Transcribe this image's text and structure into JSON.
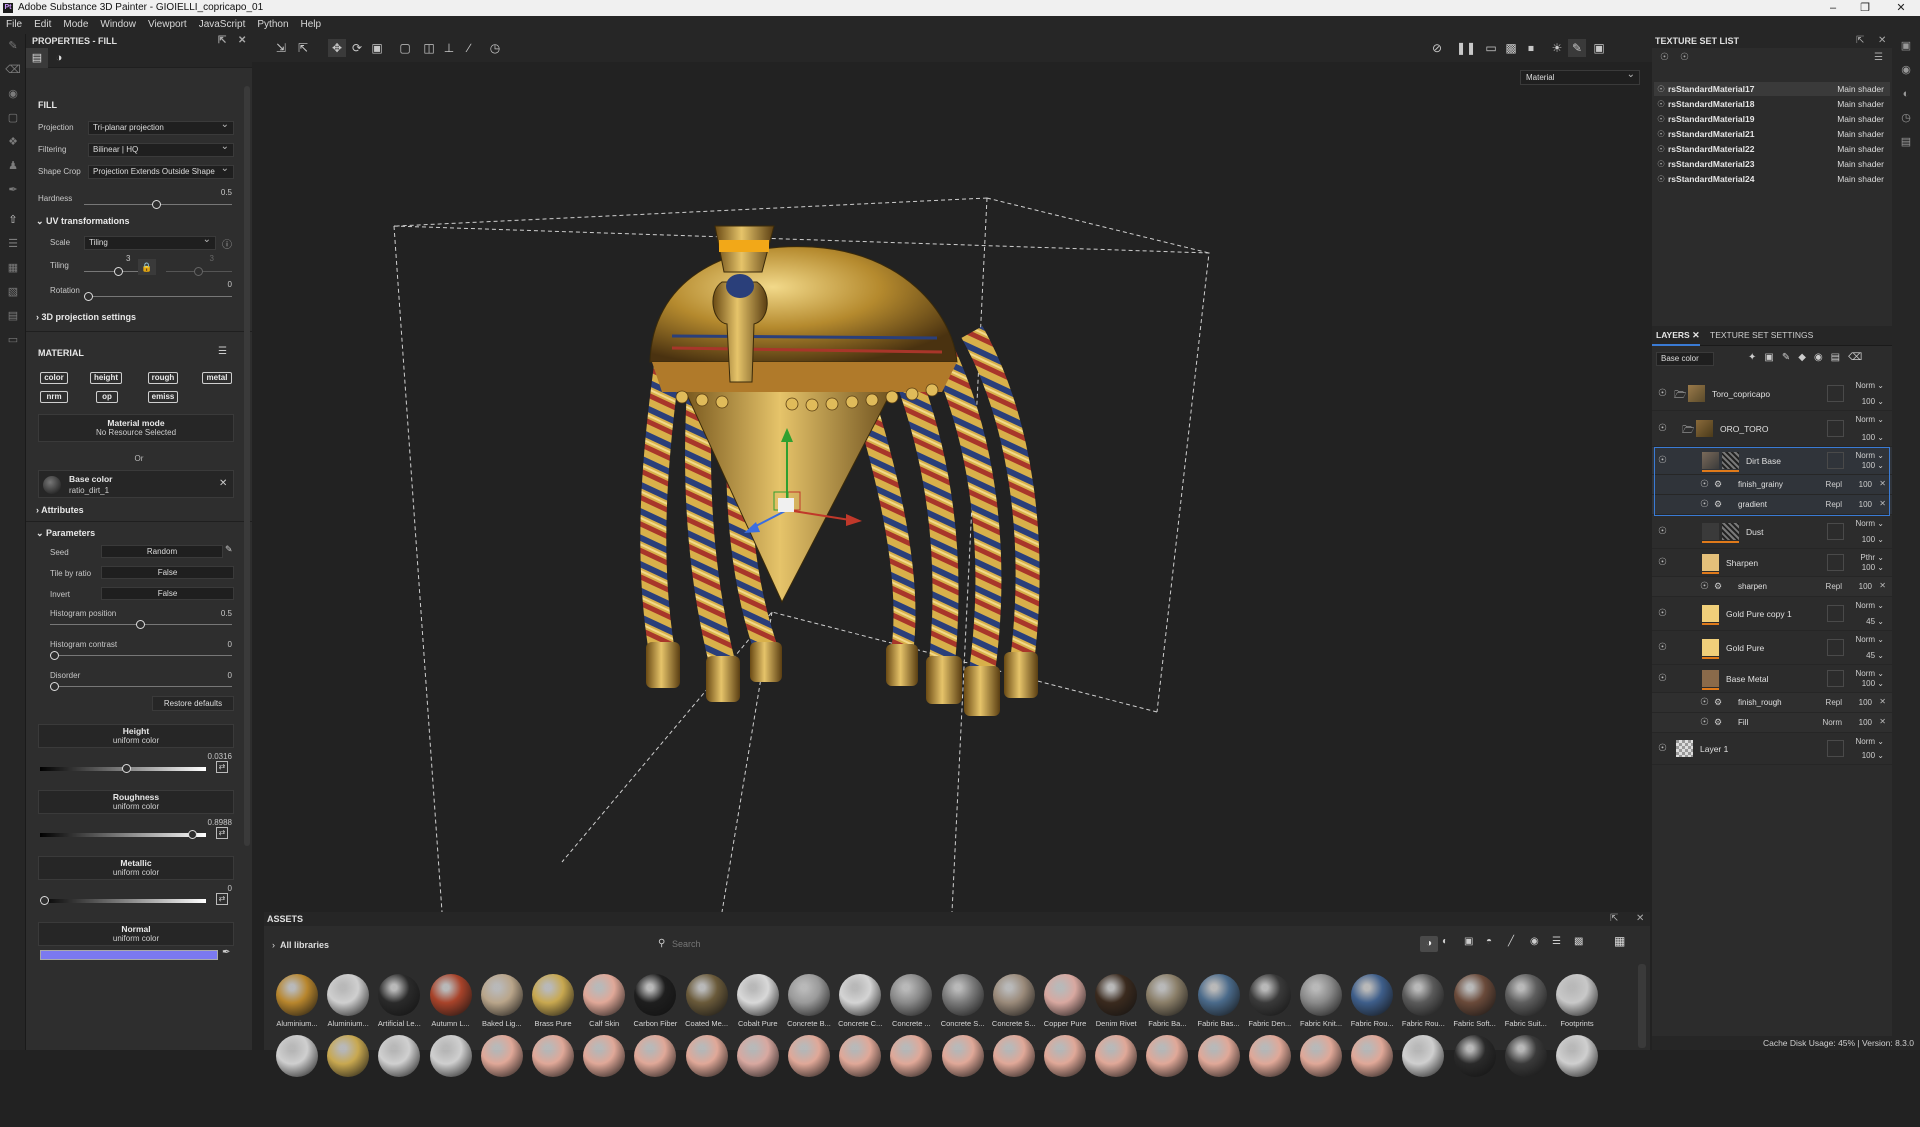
{
  "window": {
    "title": "Adobe Substance 3D Painter - GIOIELLI_copricapo_01",
    "logo": "Pt"
  },
  "menu": [
    "File",
    "Edit",
    "Mode",
    "Window",
    "Viewport",
    "JavaScript",
    "Python",
    "Help"
  ],
  "properties": {
    "header": "PROPERTIES - FILL",
    "fill_label": "FILL",
    "projection": {
      "label": "Projection",
      "value": "Tri-planar projection"
    },
    "filtering": {
      "label": "Filtering",
      "value": "Bilinear | HQ"
    },
    "shape_crop": {
      "label": "Shape Crop",
      "value": "Projection Extends Outside Shape"
    },
    "hardness": {
      "label": "Hardness",
      "value": "0.5"
    },
    "uv_transformations": "UV transformations",
    "scale": {
      "label": "Scale",
      "value": "Tiling"
    },
    "tiling": {
      "label": "Tiling",
      "value": "3",
      "value2": "3"
    },
    "rotation": {
      "label": "Rotation",
      "value": "0"
    },
    "projection_settings": "3D projection settings",
    "material_label": "MATERIAL",
    "channels": [
      "color",
      "height",
      "rough",
      "metal",
      "nrm",
      "op",
      "emiss"
    ],
    "material_mode": {
      "title": "Material mode",
      "sub": "No Resource Selected"
    },
    "or_text": "Or",
    "base_color": {
      "title": "Base color",
      "sub": "ratio_dirt_1"
    },
    "attributes": "Attributes",
    "parameters": "Parameters",
    "seed": {
      "label": "Seed",
      "value": "Random"
    },
    "tile_by_ratio": {
      "label": "Tile by ratio",
      "value": "False"
    },
    "invert": {
      "label": "Invert",
      "value": "False"
    },
    "histogram_position": {
      "label": "Histogram position",
      "value": "0.5"
    },
    "histogram_contrast": {
      "label": "Histogram contrast",
      "value": "0"
    },
    "disorder": {
      "label": "Disorder",
      "value": "0"
    },
    "restore_defaults": "Restore defaults",
    "height": {
      "title": "Height",
      "sub": "uniform color",
      "value": "0.0316"
    },
    "roughness": {
      "title": "Roughness",
      "sub": "uniform color",
      "value": "0.8988"
    },
    "metallic": {
      "title": "Metallic",
      "sub": "uniform color",
      "value": "0"
    },
    "normal": {
      "title": "Normal",
      "sub": "uniform color",
      "color": "#7b79f0"
    }
  },
  "viewport": {
    "material_dropdown": "Material"
  },
  "texture_set_list": {
    "header": "TEXTURE SET LIST",
    "items": [
      {
        "name": "rsStandardMaterial17",
        "shader": "Main shader"
      },
      {
        "name": "rsStandardMaterial18",
        "shader": "Main shader"
      },
      {
        "name": "rsStandardMaterial19",
        "shader": "Main shader"
      },
      {
        "name": "rsStandardMaterial21",
        "shader": "Main shader"
      },
      {
        "name": "rsStandardMaterial22",
        "shader": "Main shader"
      },
      {
        "name": "rsStandardMaterial23",
        "shader": "Main shader"
      },
      {
        "name": "rsStandardMaterial24",
        "shader": "Main shader"
      }
    ]
  },
  "layers": {
    "tab_layers": "LAYERS",
    "tab_settings": "TEXTURE SET SETTINGS",
    "channel": "Base color",
    "rows": [
      {
        "name": "Toro_copricapo",
        "blend": "Norm",
        "opacity": "100"
      },
      {
        "name": "ORO_TORO",
        "blend": "Norm",
        "opacity": "100"
      },
      {
        "name": "Dirt Base",
        "blend": "Norm",
        "opacity": "100"
      },
      {
        "name": "finish_grainy",
        "blend": "Repl",
        "opacity": "100"
      },
      {
        "name": "gradient",
        "blend": "Repl",
        "opacity": "100"
      },
      {
        "name": "Dust",
        "blend": "Norm",
        "opacity": "100"
      },
      {
        "name": "Sharpen",
        "blend": "Pthr",
        "opacity": "100"
      },
      {
        "name": "sharpen",
        "blend": "Repl",
        "opacity": "100"
      },
      {
        "name": "Gold Pure copy 1",
        "blend": "Norm",
        "opacity": "45"
      },
      {
        "name": "Gold Pure",
        "blend": "Norm",
        "opacity": "45"
      },
      {
        "name": "Base Metal",
        "blend": "Norm",
        "opacity": "100"
      },
      {
        "name": "finish_rough",
        "blend": "Repl",
        "opacity": "100"
      },
      {
        "name": "Fill",
        "blend": "Norm",
        "opacity": "100"
      },
      {
        "name": "Layer 1",
        "blend": "Norm",
        "opacity": "100"
      }
    ]
  },
  "assets": {
    "header": "ASSETS",
    "library": "All libraries",
    "search_placeholder": "Search",
    "items": [
      {
        "label": "Aluminium...",
        "color": "#b8862d"
      },
      {
        "label": "Aluminium...",
        "color": "#cfcfcf"
      },
      {
        "label": "Artificial Le...",
        "color": "#2a2a2a"
      },
      {
        "label": "Autumn L...",
        "color": "#a8432a"
      },
      {
        "label": "Baked Lig...",
        "color": "#b9a58a"
      },
      {
        "label": "Brass Pure",
        "color": "#c8a850"
      },
      {
        "label": "Calf Skin",
        "color": "#e0a898"
      },
      {
        "label": "Carbon Fiber",
        "color": "#1e1e1e"
      },
      {
        "label": "Coated Me...",
        "color": "#6a5a3a"
      },
      {
        "label": "Cobalt Pure",
        "color": "#d8d8d8"
      },
      {
        "label": "Concrete B...",
        "color": "#9a9a9a"
      },
      {
        "label": "Concrete C...",
        "color": "#d4d4d4"
      },
      {
        "label": "Concrete ...",
        "color": "#8a8a8a"
      },
      {
        "label": "Concrete S...",
        "color": "#7a7a7a"
      },
      {
        "label": "Concrete S...",
        "color": "#9a8a7a"
      },
      {
        "label": "Copper Pure",
        "color": "#d8a8a0"
      },
      {
        "label": "Denim Rivet",
        "color": "#3a2a1e"
      },
      {
        "label": "Fabric Ba...",
        "color": "#8a7e68"
      },
      {
        "label": "Fabric Bas...",
        "color": "#4a6a8a"
      },
      {
        "label": "Fabric Den...",
        "color": "#3a3a3a"
      },
      {
        "label": "Fabric Knit...",
        "color": "#8a8a8a"
      },
      {
        "label": "Fabric Rou...",
        "color": "#3e5e8a"
      },
      {
        "label": "Fabric Rou...",
        "color": "#5a5a5a"
      },
      {
        "label": "Fabric Soft...",
        "color": "#6a4a3a"
      },
      {
        "label": "Fabric Suit...",
        "color": "#5e5e5e"
      },
      {
        "label": "Footprints",
        "color": "#c8c8c8"
      }
    ]
  },
  "status": {
    "text": "Cache Disk Usage:   45% | Version: 8.3.0"
  }
}
